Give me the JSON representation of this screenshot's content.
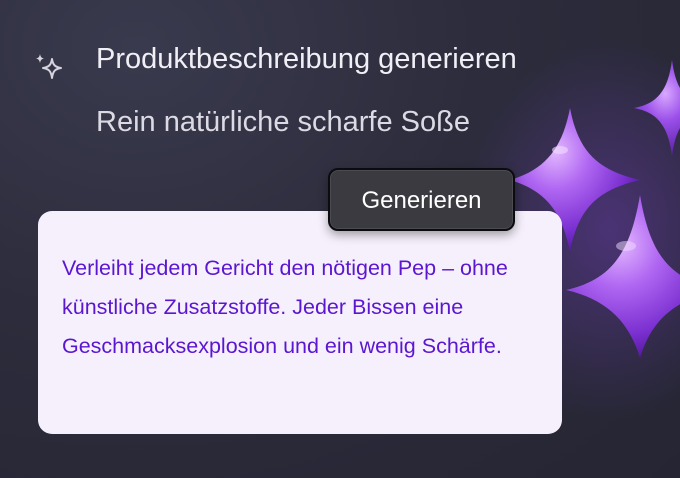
{
  "header": {
    "title": "Produktbeschreibung generieren",
    "input_value": "Rein natürliche scharfe Soße",
    "icon": "sparkle-icon"
  },
  "actions": {
    "generate_label": "Generieren"
  },
  "result": {
    "text": "Verleiht jedem Gericht den nötigen Pep – ohne künstliche Zusatzstoffe. Jeder Bissen eine Geschmacksexplosion und ein wenig Schärfe."
  },
  "colors": {
    "background": "#2c2c3c",
    "card_background": "#f6f0fc",
    "result_text": "#5a16d0",
    "button_background": "#3a3a40",
    "accent_purple": "#8b3fe0"
  }
}
